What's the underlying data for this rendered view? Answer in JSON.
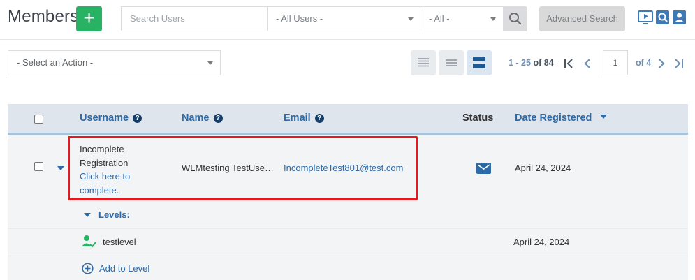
{
  "header": {
    "title": "Members",
    "add_label": "+",
    "search_placeholder": "Search Users",
    "user_filter": "- All Users -",
    "status_filter": "- All -",
    "advanced_search": "Advanced Search",
    "icons": [
      "search-icon",
      "video-help-icon",
      "search-doc-icon",
      "user-manage-icon"
    ]
  },
  "toolbar": {
    "action_select": "- Select an Action -",
    "pager_range": "1 - 25",
    "pager_total": "of 84",
    "page": "1",
    "page_of": "of 4"
  },
  "table": {
    "columns": {
      "username": "Username",
      "name": "Name",
      "email": "Email",
      "status": "Status",
      "date": "Date Registered"
    },
    "row": {
      "username_line1": "Incomplete",
      "username_line2": "Registration",
      "link_line1": "Click here to",
      "link_line2": "complete.",
      "name": "WLMtesting TestUse…",
      "email": "IncompleteTest801@test.com",
      "date": "April 24, 2024"
    },
    "levels_label": "Levels:",
    "level": {
      "name": "testlevel",
      "date": "April 24, 2024"
    },
    "add_level": "Add to Level"
  },
  "colors": {
    "accent": "#2d6aa7",
    "add_button": "#27b363",
    "highlight": "#e8161d"
  }
}
